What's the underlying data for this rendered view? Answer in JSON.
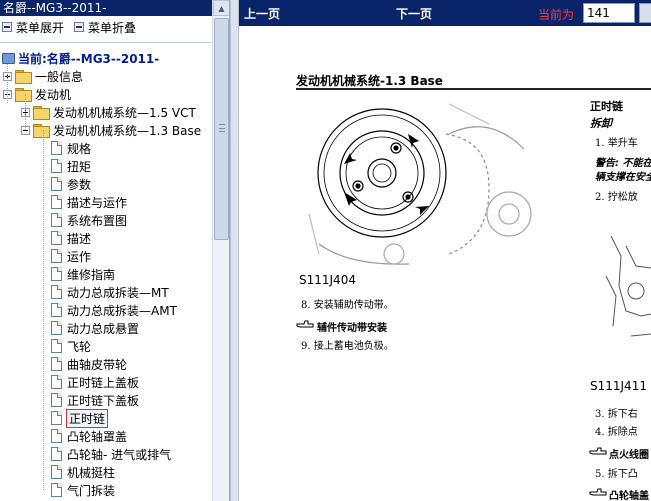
{
  "left": {
    "title": "名爵--MG3--2011-",
    "expand_all": "菜单展开",
    "collapse_all": "菜单折叠",
    "current_label": "当前:名爵--MG3--2011-"
  },
  "tree": [
    {
      "label": "一般信息",
      "type": "folder",
      "expander": "plus",
      "level": 0
    },
    {
      "label": "发动机",
      "type": "folder",
      "expander": "minus",
      "level": 0
    },
    {
      "label": "发动机机械系统—1.5 VCT",
      "type": "folder",
      "expander": "plus",
      "level": 1
    },
    {
      "label": "发动机机械系统—1.3 Base",
      "type": "folder",
      "expander": "minus",
      "level": 1
    },
    {
      "label": "规格",
      "type": "doc",
      "level": 2
    },
    {
      "label": "扭矩",
      "type": "doc",
      "level": 2
    },
    {
      "label": "参数",
      "type": "doc",
      "level": 2
    },
    {
      "label": "描述与运作",
      "type": "doc",
      "level": 2
    },
    {
      "label": "系统布置图",
      "type": "doc",
      "level": 2
    },
    {
      "label": "描述",
      "type": "doc",
      "level": 2
    },
    {
      "label": "运作",
      "type": "doc",
      "level": 2
    },
    {
      "label": "维修指南",
      "type": "doc",
      "level": 2
    },
    {
      "label": "动力总成拆装—MT",
      "type": "doc",
      "level": 2
    },
    {
      "label": "动力总成拆装—AMT",
      "type": "doc",
      "level": 2
    },
    {
      "label": "动力总成悬置",
      "type": "doc",
      "level": 2
    },
    {
      "label": "飞轮",
      "type": "doc",
      "level": 2
    },
    {
      "label": "曲轴皮带轮",
      "type": "doc",
      "level": 2
    },
    {
      "label": "正时链上盖板",
      "type": "doc",
      "level": 2
    },
    {
      "label": "正时链下盖板",
      "type": "doc",
      "level": 2
    },
    {
      "label": "正时链",
      "type": "doc",
      "level": 2,
      "selected": true
    },
    {
      "label": "凸轮轴罩盖",
      "type": "doc",
      "level": 2
    },
    {
      "label": "凸轮轴- 进气或排气",
      "type": "doc",
      "level": 2
    },
    {
      "label": "机械挺柱",
      "type": "doc",
      "level": 2
    },
    {
      "label": "气门拆装",
      "type": "doc",
      "level": 2
    }
  ],
  "toolbar": {
    "prev": "上一页",
    "next": "下一页",
    "current_label": "当前为",
    "page_value": "141"
  },
  "doc": {
    "title": "发动机机械系统-1.3 Base",
    "fig1_label": "S111J404",
    "step8": "8.  安装辅助传动带。",
    "note1": "辅件传动带安装",
    "step9": "9.  接上蓄电池负极。",
    "right_title": "正时链",
    "right_sub": "拆卸",
    "step1": "1.  举升车",
    "warning1": "警告: 不能在",
    "warning2": "辆支撑在安全",
    "step2": "2.  拧松放",
    "fig2_label": "S111J411",
    "step3": "3.  拆下右",
    "step4": "4.  拆除点",
    "note2": "点火线圈",
    "step5": "5.  拆下凸",
    "note3": "凸轮轴盖"
  },
  "colors": {
    "title_bar": "#0a246a",
    "current_label": "#ff3b3b",
    "selected_outline": "#e03030",
    "tree_root": "#001e96"
  }
}
